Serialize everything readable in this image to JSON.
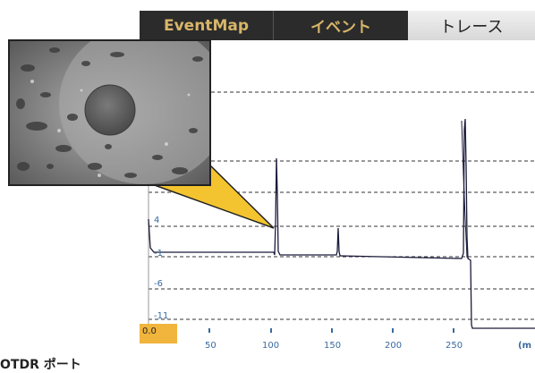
{
  "tabs": [
    {
      "label": "EventMap",
      "active": false
    },
    {
      "label": "イベント",
      "active": false
    },
    {
      "label": "トレース",
      "active": true
    }
  ],
  "plot": {
    "y_ticks": [
      "4",
      "-1",
      "-6",
      "-11"
    ],
    "x_ticks": [
      "50",
      "100",
      "150",
      "200",
      "250",
      "(m"
    ],
    "origin_label": "0.0"
  },
  "footer": {
    "label": "OTDR ポート"
  },
  "colors": {
    "tab_bg": "#2b2b2b",
    "tab_text": "#d8b56a",
    "origin_bg": "#f1b43c",
    "axis_text": "#3a6aa0",
    "callout": "#f4c430"
  }
}
